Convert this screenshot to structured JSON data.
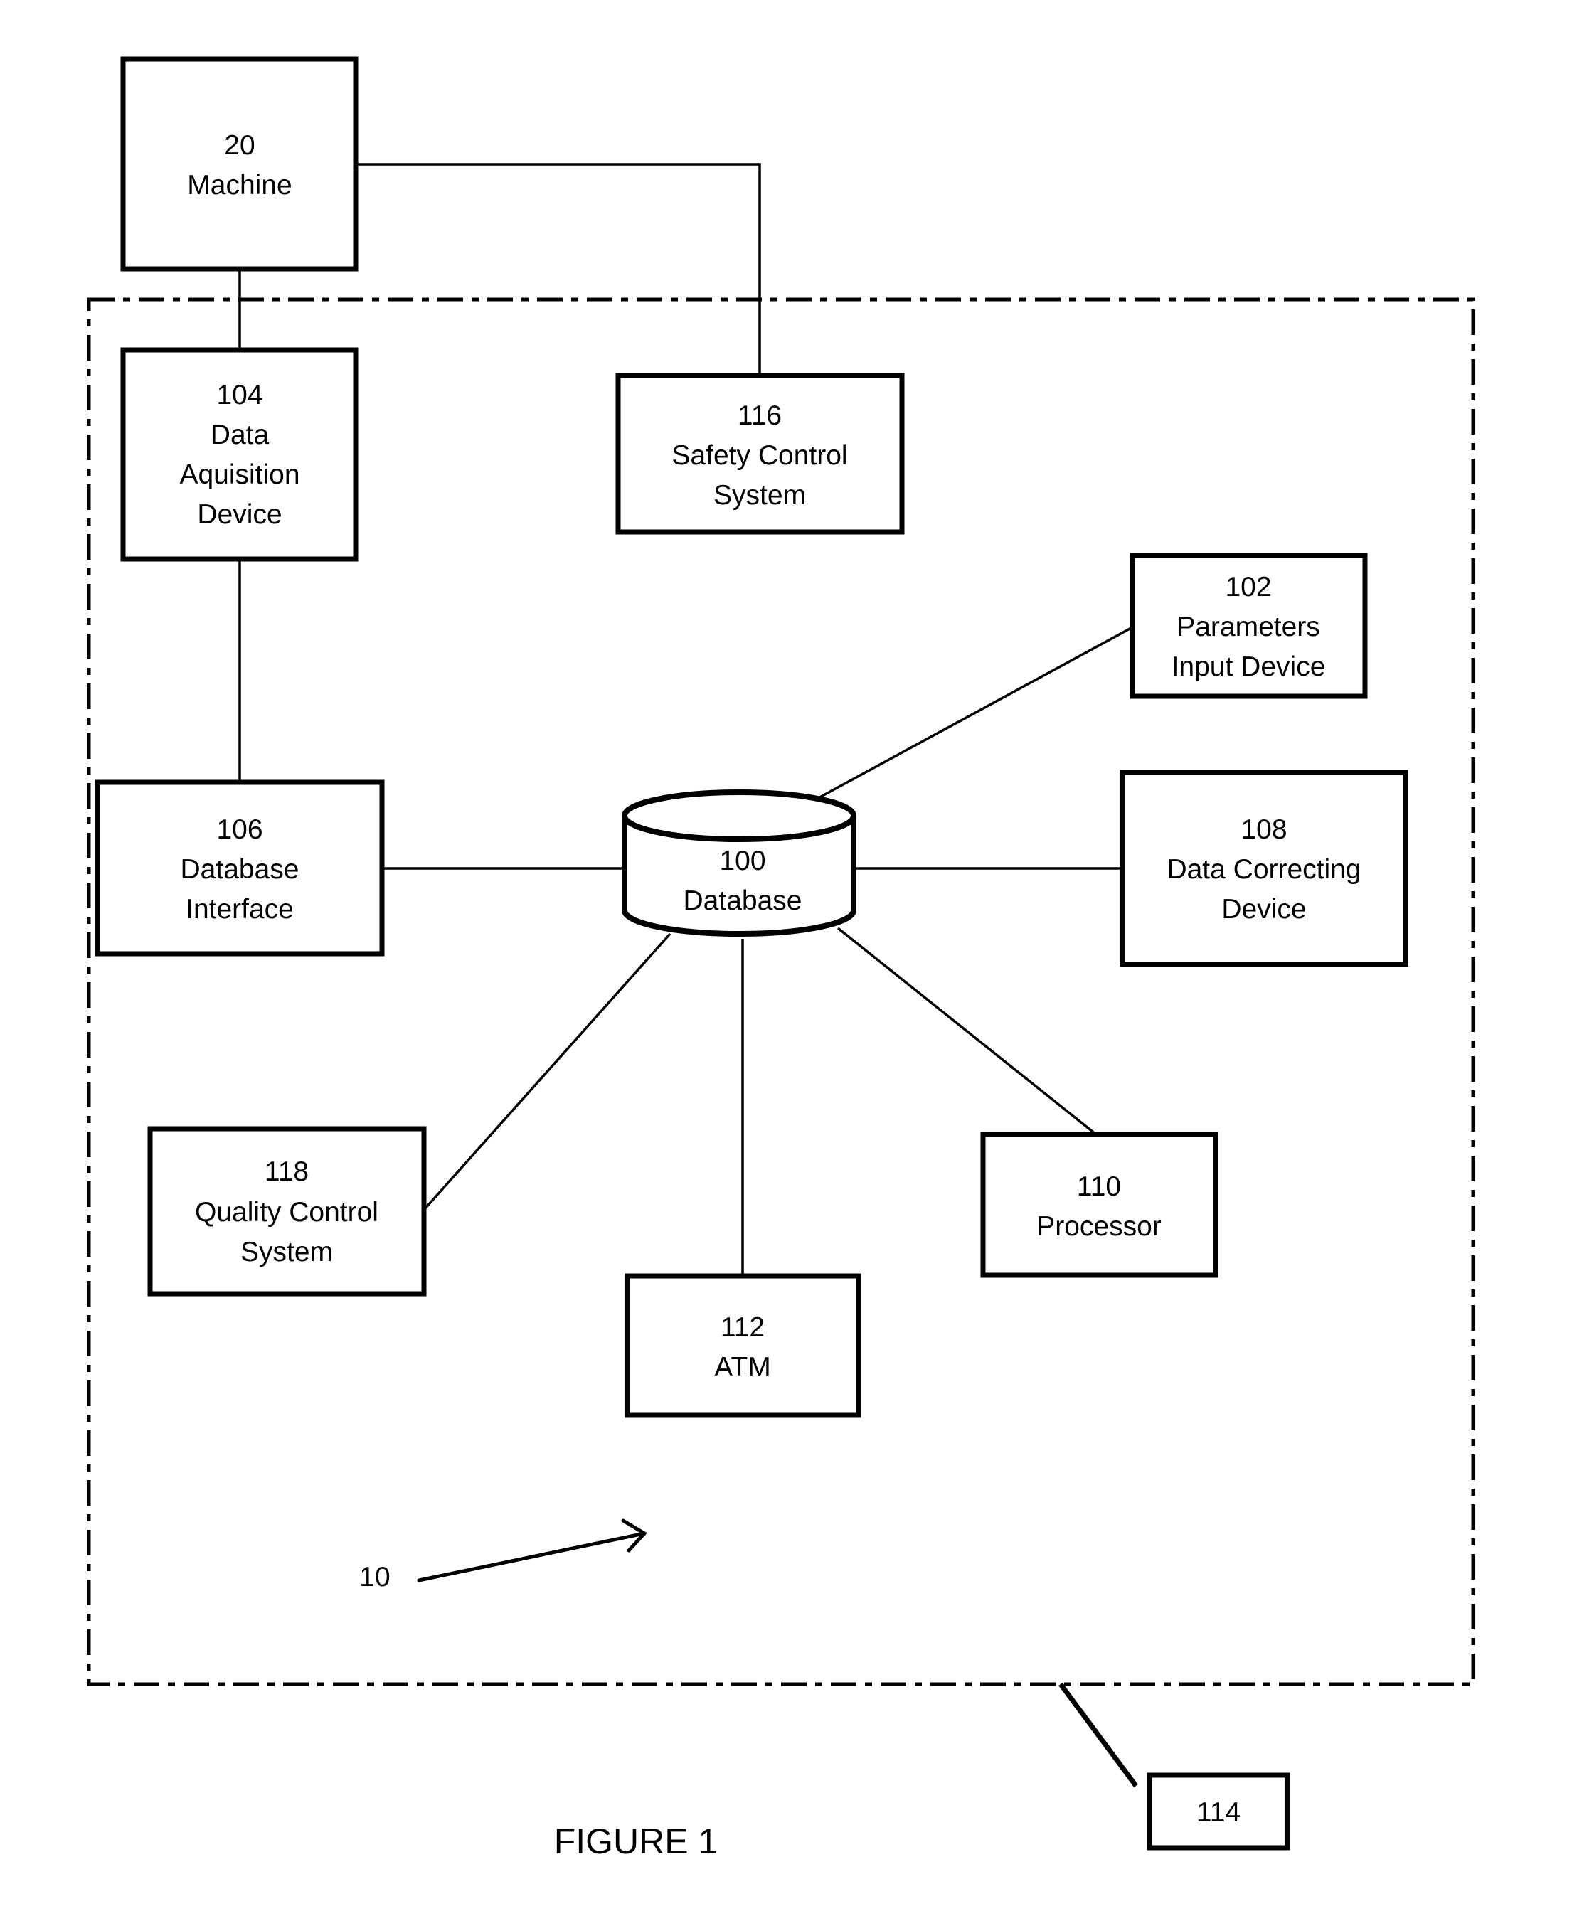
{
  "figure_label": "FIGURE 1",
  "system_ref": "10",
  "colors": {
    "ink": "#000000",
    "background": "#ffffff"
  },
  "nodes": {
    "machine": {
      "number": "20",
      "lines": [
        "Machine"
      ]
    },
    "data_acquisition": {
      "number": "104",
      "lines": [
        "Data",
        "Aquisition",
        "Device"
      ]
    },
    "safety_control": {
      "number": "116",
      "lines": [
        "Safety Control",
        "System"
      ]
    },
    "parameters_input": {
      "number": "102",
      "lines": [
        "Parameters",
        "Input Device"
      ]
    },
    "database_interface": {
      "number": "106",
      "lines": [
        "Database",
        "Interface"
      ]
    },
    "database": {
      "number": "100",
      "lines": [
        "Database"
      ]
    },
    "data_correcting": {
      "number": "108",
      "lines": [
        "Data Correcting",
        "Device"
      ]
    },
    "quality_control": {
      "number": "118",
      "lines": [
        "Quality Control",
        "System"
      ]
    },
    "processor": {
      "number": "110",
      "lines": [
        "Processor"
      ]
    },
    "atm": {
      "number": "112",
      "lines": [
        "ATM"
      ]
    },
    "external": {
      "number": "114",
      "lines": []
    }
  },
  "connections": [
    [
      "machine",
      "data_acquisition"
    ],
    [
      "machine",
      "safety_control"
    ],
    [
      "data_acquisition",
      "database_interface"
    ],
    [
      "database_interface",
      "database"
    ],
    [
      "database",
      "parameters_input"
    ],
    [
      "database",
      "data_correcting"
    ],
    [
      "database",
      "quality_control"
    ],
    [
      "database",
      "atm"
    ],
    [
      "database",
      "processor"
    ],
    [
      "system_boundary",
      "external"
    ]
  ]
}
